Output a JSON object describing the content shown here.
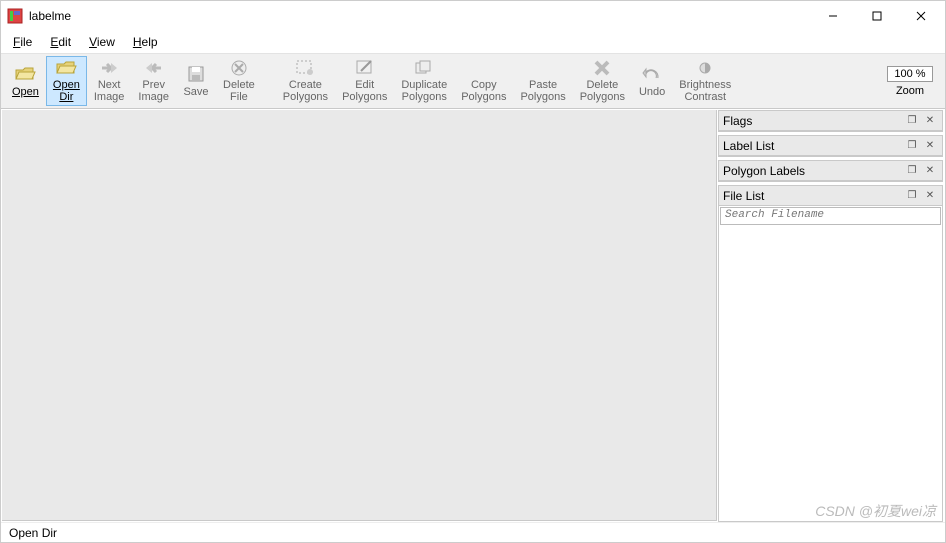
{
  "app": {
    "title": "labelme"
  },
  "menu": {
    "file": "File",
    "edit": "Edit",
    "view": "View",
    "help": "Help"
  },
  "toolbar": {
    "open": "Open",
    "open_dir": "Open\nDir",
    "next": "Next\nImage",
    "prev": "Prev\nImage",
    "save": "Save",
    "delete_file": "Delete\nFile",
    "create": "Create\nPolygons",
    "edit": "Edit\nPolygons",
    "duplicate": "Duplicate\nPolygons",
    "copy": "Copy\nPolygons",
    "paste": "Paste\nPolygons",
    "delete": "Delete\nPolygons",
    "undo": "Undo",
    "brightness": "Brightness\nContrast",
    "zoom_value": "100 %",
    "zoom": "Zoom"
  },
  "panels": {
    "flags": "Flags",
    "label_list": "Label List",
    "polygon_labels": "Polygon Labels",
    "file_list": "File List",
    "search_placeholder": "Search Filename"
  },
  "status": {
    "text": "Open Dir"
  },
  "watermark": "CSDN @初夏wei凉"
}
